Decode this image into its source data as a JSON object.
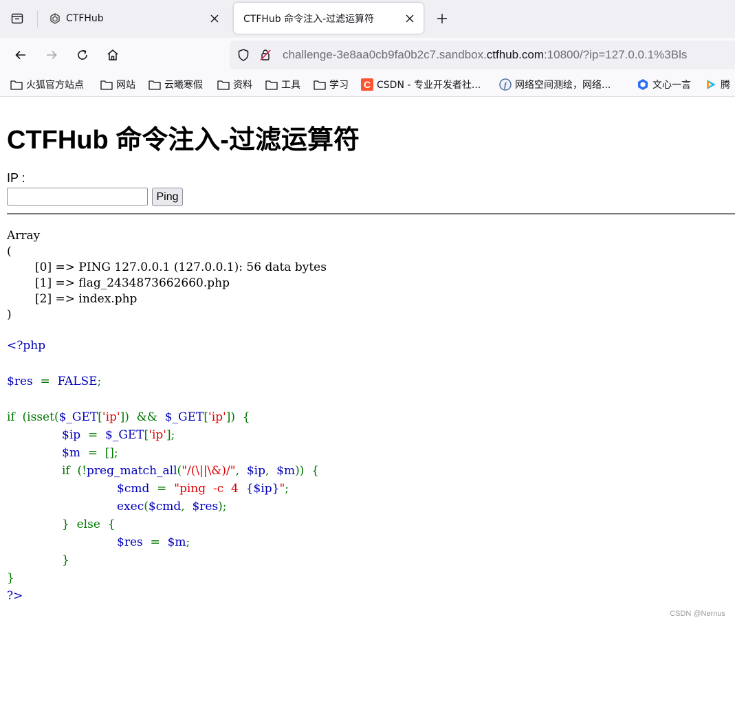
{
  "browser": {
    "tabs": [
      {
        "title": "CTFHub",
        "active": false
      },
      {
        "title": "CTFHub 命令注入-过滤运算符",
        "active": true
      }
    ],
    "url": {
      "prefix": "challenge-3e8aa0cb9fa0b2c7.sandbox.",
      "domain": "ctfhub.com",
      "suffix": ":10800/?ip=127.0.0.1%3Bls"
    },
    "bookmarks": [
      {
        "label": "火狐官方站点",
        "icon": "folder-icon"
      },
      {
        "label": "网站",
        "icon": "folder-icon"
      },
      {
        "label": "云曦寒假",
        "icon": "folder-icon"
      },
      {
        "label": "资料",
        "icon": "folder-icon"
      },
      {
        "label": "工具",
        "icon": "folder-icon"
      },
      {
        "label": "学习",
        "icon": "folder-icon"
      },
      {
        "label": "CSDN - 专业开发者社...",
        "icon": "csdn-icon"
      },
      {
        "label": "网络空间测绘，网络...",
        "icon": "fofa-icon"
      },
      {
        "label": "文心一言",
        "icon": "wenxin-icon"
      },
      {
        "label": "腾",
        "icon": "tencent-video-icon"
      }
    ]
  },
  "page": {
    "title": "CTFHub 命令注入-过滤运算符",
    "ip_label": "IP :",
    "ip_value": "",
    "ping_label": "Ping",
    "output": {
      "open": "Array",
      "paren_open": "(",
      "items": [
        "[0] => PING 127.0.0.1 (127.0.0.1): 56 data bytes",
        "[1] => flag_2434873662660.php",
        "[2] => index.php"
      ],
      "paren_close": ")"
    },
    "source": {
      "l1": "<?php",
      "l3_a": "$res",
      "l3_b": "  =  ",
      "l3_c": "FALSE",
      "l3_d": ";",
      "l5_a": "if  (isset(",
      "l5_b": "$_GET",
      "l5_c": "[",
      "l5_d": "'ip'",
      "l5_e": "])  &&  ",
      "l5_f": "$_GET",
      "l5_g": "[",
      "l5_h": "'ip'",
      "l5_i": "])  {",
      "l6_a": "$ip",
      "l6_b": "  =  ",
      "l6_c": "$_GET",
      "l6_d": "[",
      "l6_e": "'ip'",
      "l6_f": "];",
      "l7_a": "$m",
      "l7_b": "  =  [];",
      "l8_a": "if  (!",
      "l8_b": "preg_match_all",
      "l8_c": "(",
      "l8_d": "\"/(\\||\\&)/\"",
      "l8_e": ",  ",
      "l8_f": "$ip",
      "l8_g": ",  ",
      "l8_h": "$m",
      "l8_i": "))  {",
      "l9_a": "$cmd",
      "l9_b": "  =  ",
      "l9_c": "\"ping  -c  4  ",
      "l9_d": "{$ip}",
      "l9_e": "\"",
      "l9_f": ";",
      "l10_a": "exec",
      "l10_b": "(",
      "l10_c": "$cmd",
      "l10_d": ",  ",
      "l10_e": "$res",
      "l10_f": ");",
      "l11": "}  else  {",
      "l12_a": "$res",
      "l12_b": "  =  ",
      "l12_c": "$m",
      "l12_d": ";",
      "l13": "}",
      "l14": "}",
      "l15": "?>"
    }
  },
  "watermark": "CSDN @Nernus",
  "colors": {
    "php_default": "#0000bb",
    "php_keyword": "#007700",
    "php_string": "#dd0000",
    "csdn_brand": "#fc5531"
  }
}
